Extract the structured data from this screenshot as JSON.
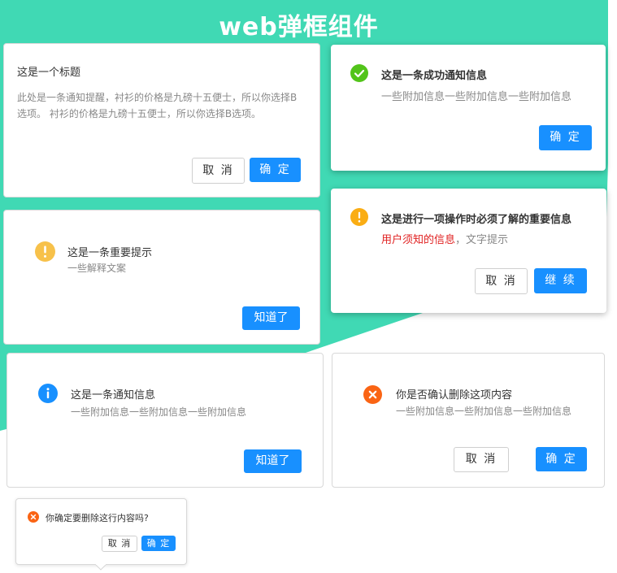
{
  "page": {
    "title": "web弹框组件"
  },
  "colors": {
    "accent_bg": "#40d9b4",
    "primary": "#1890ff",
    "success": "#52c41a",
    "warning": "#faad14",
    "warning_light": "#f7c14a",
    "info": "#1890ff",
    "error": "#fa6414",
    "emphasis": "#e02020"
  },
  "dialog_basic": {
    "title": "这是一个标题",
    "body": "此处是一条通知提醒，衬衫的价格是九磅十五便士，所以你选择B选项。 衬衫的价格是九磅十五便士，所以你选择B选项。",
    "cancel": "取 消",
    "ok": "确 定"
  },
  "dialog_success": {
    "icon": "check-circle-icon",
    "title": "这是一条成功通知信息",
    "desc": "一些附加信息一些附加信息一些附加信息",
    "ok": "确 定"
  },
  "dialog_important": {
    "icon": "exclamation-circle-icon",
    "title": "这是一条重要提示",
    "desc": "一些解释文案",
    "ok": "知道了"
  },
  "dialog_warning": {
    "icon": "exclamation-circle-icon",
    "title": "这是进行一项操作时必须了解的重要信息",
    "desc_emphasis": "用户须知的信息",
    "desc_rest": "，文字提示",
    "cancel": "取 消",
    "ok": "继 续"
  },
  "dialog_info": {
    "icon": "info-circle-icon",
    "title": "这是一条通知信息",
    "desc": "一些附加信息一些附加信息一些附加信息",
    "ok": "知道了"
  },
  "dialog_delete": {
    "icon": "close-circle-icon",
    "title": "你是否确认删除这项内容",
    "desc": "一些附加信息一些附加信息一些附加信息",
    "cancel": "取 消",
    "ok": "确 定"
  },
  "popconfirm": {
    "icon": "close-circle-icon",
    "text": "你确定要删除这行内容吗?",
    "cancel": "取 消",
    "ok": "确 定"
  }
}
